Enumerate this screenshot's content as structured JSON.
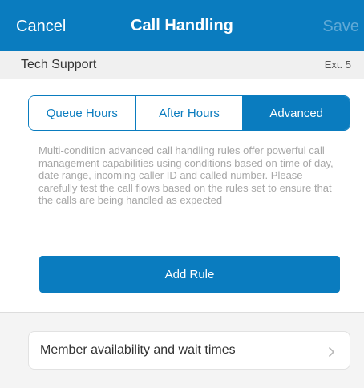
{
  "nav": {
    "cancel_label": "Cancel",
    "title": "Call Handling",
    "save_label": "Save"
  },
  "subheader": {
    "name": "Tech Support",
    "extension": "Ext. 5"
  },
  "tabs": [
    {
      "label": "Queue Hours",
      "selected": false
    },
    {
      "label": "After Hours",
      "selected": false
    },
    {
      "label": "Advanced",
      "selected": true
    }
  ],
  "description": "Multi-condition advanced call handling rules offer powerful call management capabilities using conditions based on time of day, date range, incoming caller ID and called number. Please carefully test the call flows based on the rules set to ensure that the calls are being handled as expected",
  "add_rule_label": "Add Rule",
  "member_row": {
    "label": "Member availability and wait times",
    "icon": "chevron-right-icon"
  },
  "colors": {
    "accent": "#0a7cbf",
    "save_disabled": "#5fa9d6",
    "description_text": "#a7a7a7"
  }
}
